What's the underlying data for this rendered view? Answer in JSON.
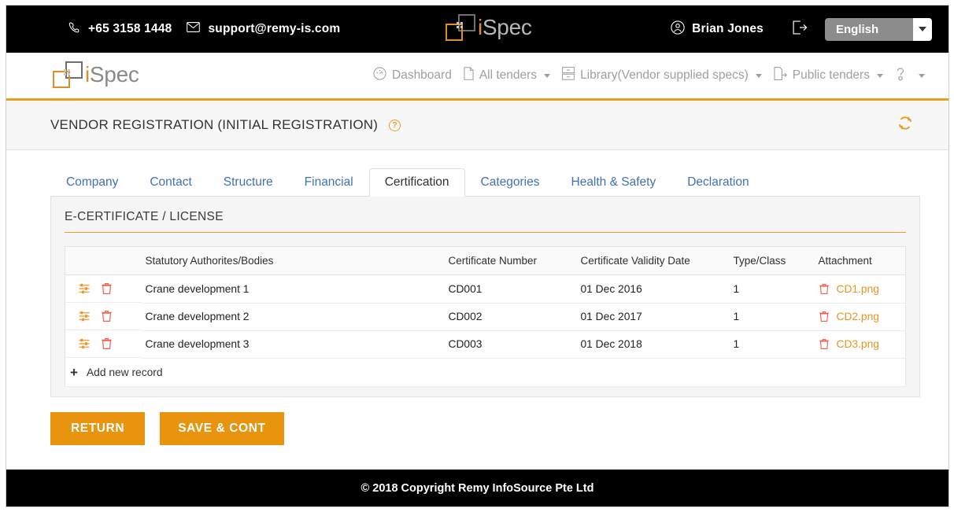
{
  "topbar": {
    "phone_icon": "phone-icon",
    "phone": "+65 3158 1448",
    "mail_icon": "mail-icon",
    "email": "support@remy-is.com",
    "logo_i": "i",
    "logo_spec": "Spec",
    "user_icon": "user-circle-icon",
    "user_name": "Brian Jones",
    "logout_icon": "logout-icon",
    "language": "English",
    "language_options": [
      "English"
    ]
  },
  "navbar": {
    "logo_i": "i",
    "logo_spec": "Spec",
    "items": [
      {
        "label": "Dashboard",
        "icon": "dashboard-gauge-icon",
        "caret": false
      },
      {
        "label": "All tenders",
        "icon": "document-icon",
        "caret": true
      },
      {
        "label": "Library(Vendor supplied specs)",
        "icon": "library-drawers-icon",
        "caret": true
      },
      {
        "label": "Public tenders",
        "icon": "document-arrow-icon",
        "caret": true
      },
      {
        "label": "",
        "icon": "help-question-icon",
        "caret": true
      }
    ]
  },
  "page": {
    "title": "VENDOR REGISTRATION (INITIAL REGISTRATION)",
    "help_badge": "?",
    "refresh_icon": "refresh-icon"
  },
  "tabs": [
    {
      "label": "Company",
      "active": false
    },
    {
      "label": "Contact",
      "active": false
    },
    {
      "label": "Structure",
      "active": false
    },
    {
      "label": "Financial",
      "active": false
    },
    {
      "label": "Certification",
      "active": true
    },
    {
      "label": "Categories",
      "active": false
    },
    {
      "label": "Health & Safety",
      "active": false
    },
    {
      "label": "Declaration",
      "active": false
    }
  ],
  "panel": {
    "title": "E-CERTIFICATE / LICENSE",
    "columns": [
      "",
      "Statutory Authorites/Bodies",
      "Certificate Number",
      "Certificate Validity Date",
      "Type/Class",
      "Attachment"
    ],
    "rows": [
      {
        "edit_icon": "sliders-settings-icon",
        "delete_icon": "trash-icon",
        "authority": "Crane development 1",
        "certificate_number": "CD001",
        "validity_date": "01 Dec 2016",
        "type_class": "1",
        "attachment_icon": "trash-icon",
        "attachment": "CD1.png"
      },
      {
        "edit_icon": "sliders-settings-icon",
        "delete_icon": "trash-icon",
        "authority": "Crane development 2",
        "certificate_number": "CD002",
        "validity_date": "01 Dec 2017",
        "type_class": "1",
        "attachment_icon": "trash-icon",
        "attachment": "CD2.png"
      },
      {
        "edit_icon": "sliders-settings-icon",
        "delete_icon": "trash-icon",
        "authority": "Crane development 3",
        "certificate_number": "CD003",
        "validity_date": "01 Dec 2018",
        "type_class": "1",
        "attachment_icon": "trash-icon",
        "attachment": "CD3.png"
      }
    ],
    "add_new_label": "Add new record",
    "add_new_icon": "plus-icon"
  },
  "actions": {
    "return_label": "RETURN",
    "save_label": "SAVE & CONT"
  },
  "footer": {
    "copyright": "© 2018 Copyright  Remy InfoSource Pte Ltd"
  },
  "colors": {
    "brand_orange": "#e8940f",
    "link_blue": "#4171b5",
    "trash_red": "#f0604d",
    "bar_black": "#000000",
    "lang_gray": "#8c8c8c"
  }
}
